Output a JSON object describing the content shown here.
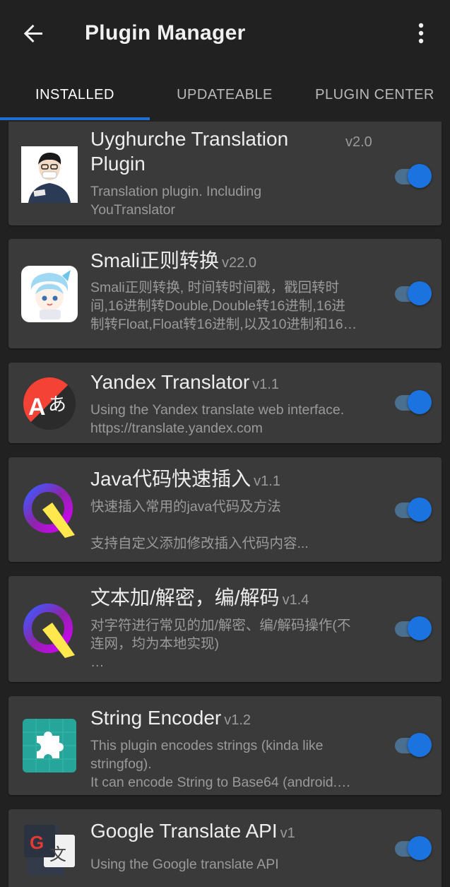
{
  "appbar": {
    "title": "Plugin Manager",
    "back_icon": "arrow-back-icon",
    "menu_icon": "more-vert-icon"
  },
  "tabs": [
    {
      "label": "INSTALLED",
      "active": true
    },
    {
      "label": "UPDATEABLE",
      "active": false
    },
    {
      "label": "PLUGIN CENTER",
      "active": false
    }
  ],
  "colors": {
    "accent": "#1e6fd1",
    "background": "#212121",
    "card": "#3a3a3a"
  },
  "plugins": [
    {
      "name_line1": "Uyghurche Translation",
      "name_line2": "Plugin",
      "version": "v2.0",
      "description": " Translation plugin. Including\nYouTranslator",
      "enabled": true,
      "icon": "avatar-icon"
    },
    {
      "name": "Smali正则转换",
      "version": "v22.0",
      "description": "Smali正则转换, 时间转时间戳，戳回转时\n间,16进制转Double,Double转16进制,16进\n制转Float,Float转16进制,以及10进制和16…",
      "enabled": true,
      "icon": "anime-character-icon"
    },
    {
      "name": "Yandex Translator",
      "version": "v1.1",
      "description": "Using the Yandex translate web interface.\nhttps://translate.yandex.com",
      "enabled": true,
      "icon": "yandex-translate-icon"
    },
    {
      "name": "Java代码快速插入",
      "version": "v1.1",
      "description": "快速插入常用的java代码及方法\n\n支持自定义添加修改插入代码内容...",
      "enabled": true,
      "icon": "q-logo-icon"
    },
    {
      "name": "文本加/解密，编/解码",
      "version": "v1.4",
      "description": "对字符进行常见的加/解密、编/解码操作(不\n连网，均为本地实现)\n  …",
      "enabled": true,
      "icon": "q-logo-icon"
    },
    {
      "name": "String Encoder",
      "version": "v1.2",
      "description": "This plugin encodes strings (kinda like\nstringfog).\nIt can encode String to Base64 (android.…",
      "enabled": true,
      "icon": "puzzle-piece-icon"
    },
    {
      "name": "Google Translate API",
      "version": "v1",
      "description": "Using the Google translate API",
      "enabled": true,
      "icon": "google-translate-icon"
    }
  ]
}
